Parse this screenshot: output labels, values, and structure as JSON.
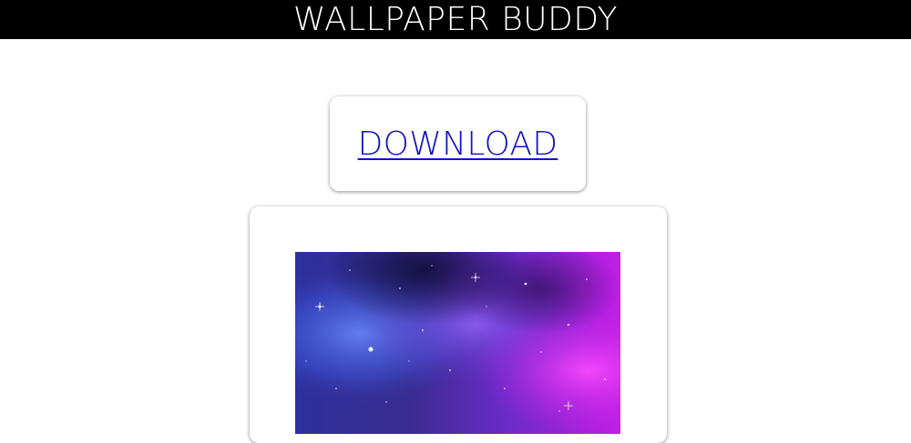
{
  "header": {
    "title": "WALLPAPER BUDDY",
    "background": "#000000",
    "color": "#ffffff"
  },
  "download": {
    "label": "DOWNLOAD",
    "link_color": "#1111cc"
  },
  "preview": {
    "image_subject": "galaxy-nebula-wallpaper",
    "colors": [
      "#2c2f9c",
      "#3a2c8f",
      "#6a2bc8",
      "#c21ee6"
    ]
  }
}
